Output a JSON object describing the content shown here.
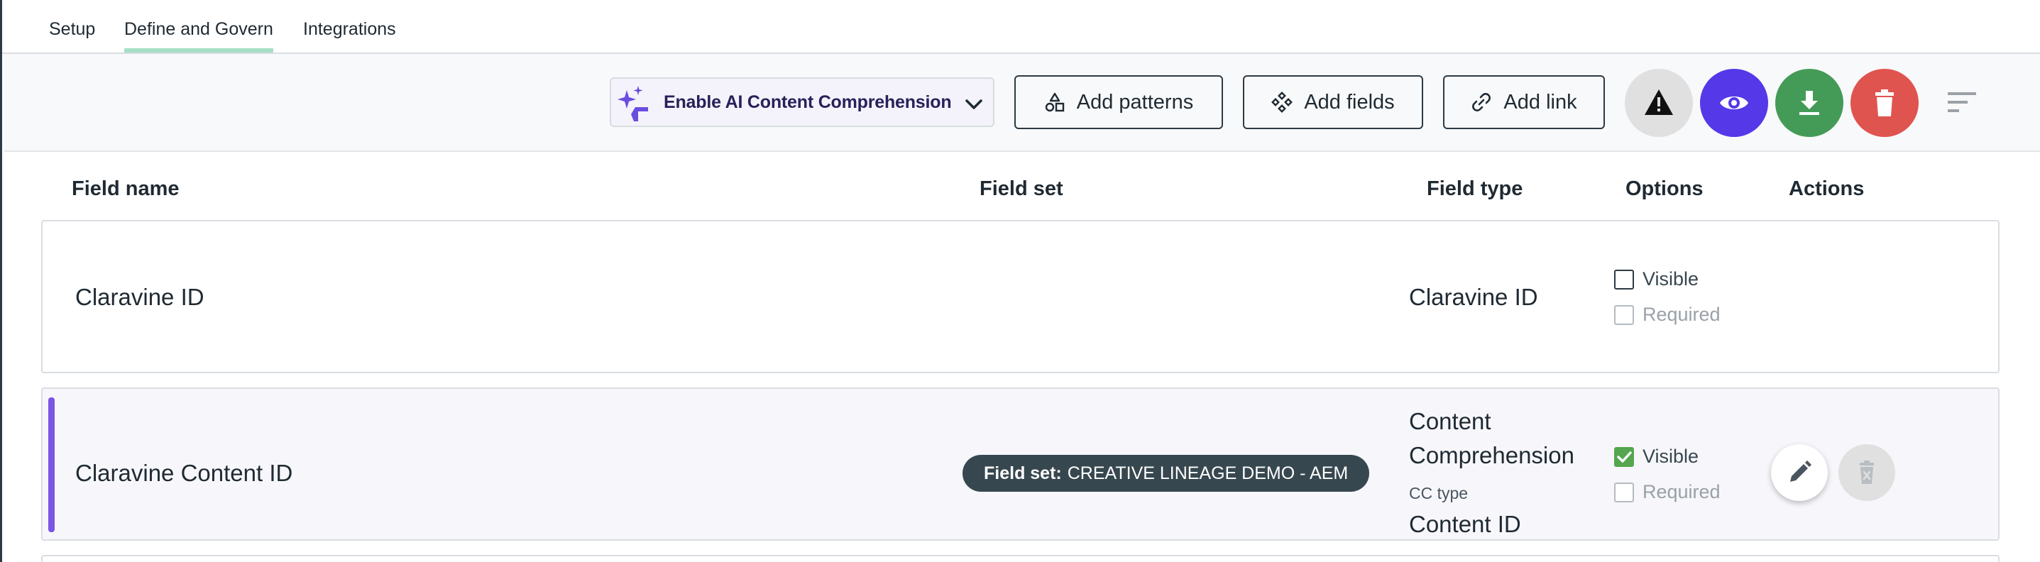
{
  "tabs": [
    {
      "label": "Setup"
    },
    {
      "label": "Define and Govern",
      "active": true
    },
    {
      "label": "Integrations"
    }
  ],
  "toolbar": {
    "ai_select_label": "Enable AI Content Comprehension",
    "add_patterns_label": "Add patterns",
    "add_fields_label": "Add fields",
    "add_link_label": "Add link",
    "circle_buttons": [
      {
        "name": "warning",
        "color": "#e0e0e0"
      },
      {
        "name": "preview",
        "color": "#5538e8"
      },
      {
        "name": "download",
        "color": "#449b57"
      },
      {
        "name": "delete",
        "color": "#e0544f"
      }
    ]
  },
  "table": {
    "headers": {
      "field_name": "Field name",
      "field_set": "Field set",
      "field_type": "Field type",
      "options": "Options",
      "actions": "Actions"
    },
    "rows": [
      {
        "field_name": "Claravine ID",
        "field_set": "",
        "field_type": "Claravine ID",
        "visible_label": "Visible",
        "visible_checked": false,
        "required_label": "Required",
        "required_checked": false
      },
      {
        "field_name": "Claravine Content ID",
        "field_set_prefix": "Field set:",
        "field_set": "CREATIVE LINEAGE DEMO - AEM",
        "field_type_line1": "Content",
        "field_type_line2": "Comprehension",
        "cc_type_label": "CC type",
        "cc_type_value": "Content ID",
        "visible_label": "Visible",
        "visible_checked": true,
        "required_label": "Required",
        "required_checked": false
      }
    ]
  },
  "colors": {
    "accent_purple": "#7a54e3",
    "tab_underline": "#a7dfc6",
    "pill_bg": "#37474f",
    "check_green": "#55a64f"
  }
}
